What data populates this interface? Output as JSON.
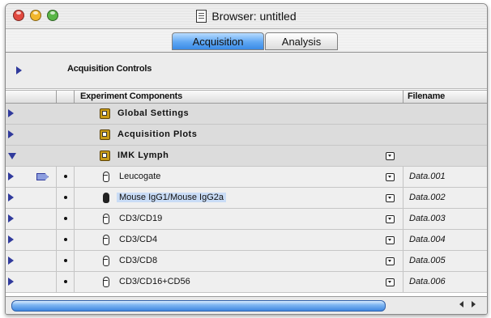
{
  "window": {
    "title": "Browser: untitled"
  },
  "tabs": [
    {
      "label": "Acquisition",
      "selected": true
    },
    {
      "label": "Analysis",
      "selected": false
    }
  ],
  "acquisition_controls": {
    "label": "Acquisition Controls"
  },
  "columns": {
    "components": "Experiment Components",
    "filename": "Filename"
  },
  "groups": [
    {
      "label": "Global Settings",
      "icon": "settings-folder-icon",
      "expanded": false
    },
    {
      "label": "Acquisition Plots",
      "icon": "plots-folder-icon",
      "expanded": false
    },
    {
      "label": "IMK Lymph",
      "icon": "experiment-folder-icon",
      "expanded": true,
      "has_menu": true
    }
  ],
  "items": [
    {
      "label": "Leucogate",
      "filename": "Data.001",
      "selected": false,
      "current": true
    },
    {
      "label": "Mouse IgG1/Mouse IgG2a",
      "filename": "Data.002",
      "selected": true,
      "current": false
    },
    {
      "label": "CD3/CD19",
      "filename": "Data.003",
      "selected": false,
      "current": false
    },
    {
      "label": "CD3/CD4",
      "filename": "Data.004",
      "selected": false,
      "current": false
    },
    {
      "label": "CD3/CD8",
      "filename": "Data.005",
      "selected": false,
      "current": false
    },
    {
      "label": "CD3/CD16+CD56",
      "filename": "Data.006",
      "selected": false,
      "current": false
    }
  ],
  "colors": {
    "accent": "#3b8be6",
    "triangle": "#303a9c",
    "selection": "#c9dcf6"
  }
}
